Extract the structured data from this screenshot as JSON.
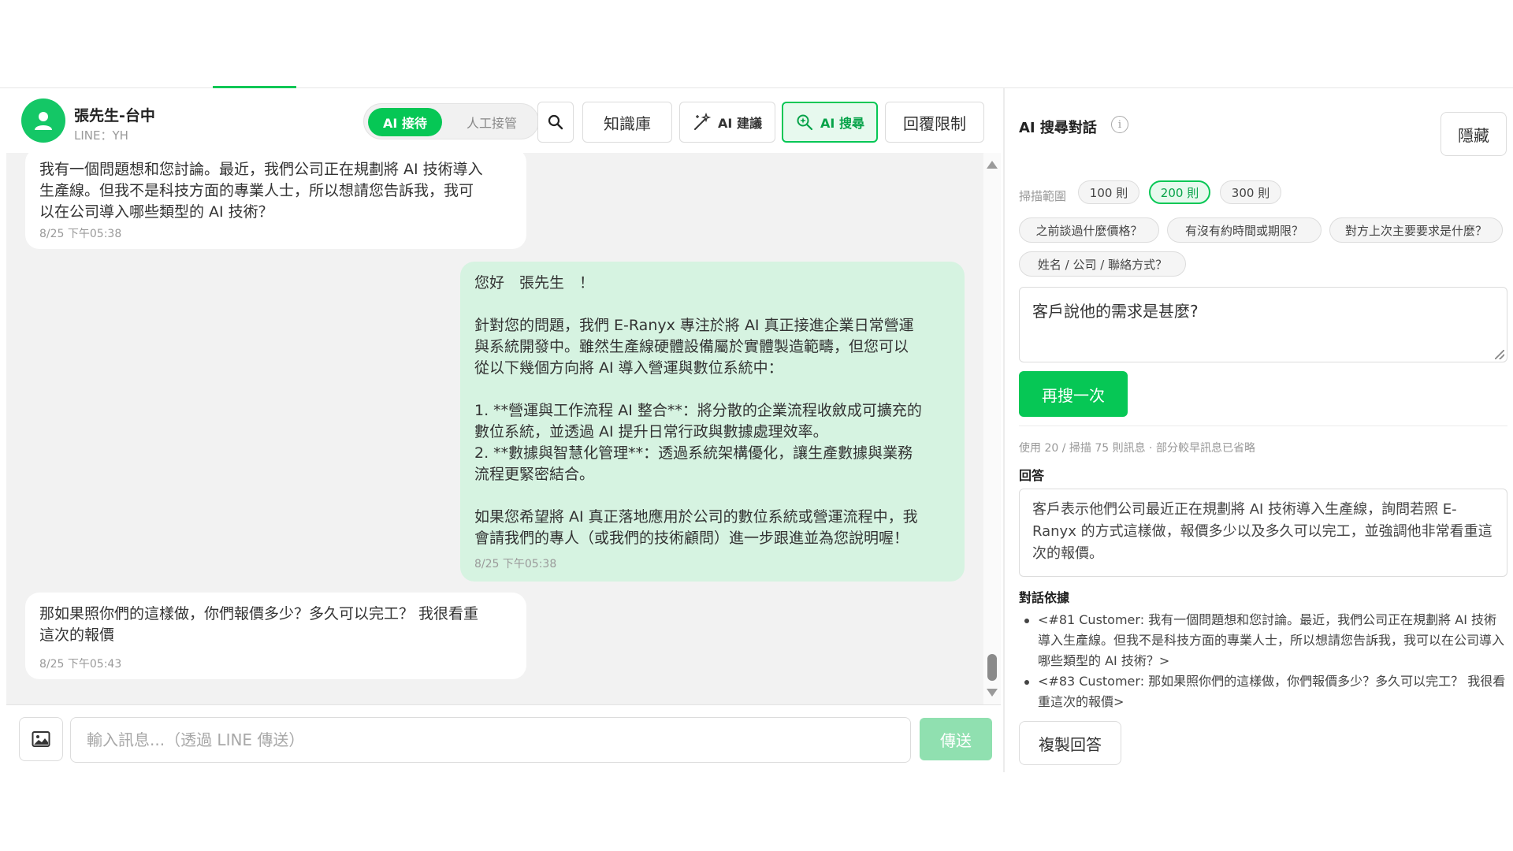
{
  "contact": {
    "name": "張先生-台中",
    "sub": "LINE：YH"
  },
  "header": {
    "mode_ai": "AI 接待",
    "mode_human": "人工接管",
    "knowledge_base": "知識庫",
    "ai_suggest": "AI 建議",
    "ai_search": "AI 搜尋",
    "reply_limit": "回覆限制"
  },
  "messages": [
    {
      "direction": "incoming",
      "text": "我有一個問題想和您討論。最近，我們公司正在規劃將 AI 技術導入\n生產線。但我不是科技方面的專業人士，所以想請您告訴我，我可\n以在公司導入哪些類型的 AI 技術？",
      "time": "8/25 下午05:38"
    },
    {
      "direction": "outgoing",
      "text": "您好　張先生　！\n\n針對您的問題，我們 E-Ranyx 專注於將 AI 真正接進企業日常營運\n與系統開發中。雖然生產線硬體設備屬於實體製造範疇，但您可以\n從以下幾個方向將 AI 導入營運與數位系統中：\n\n1. **營運與工作流程 AI 整合**：將分散的企業流程收斂成可擴充的\n數位系統，並透過 AI 提升日常行政與數據處理效率。\n2. **數據與智慧化管理**：透過系統架構優化，讓生產數據與業務\n流程更緊密結合。\n\n如果您希望將 AI 真正落地應用於公司的數位系統或營運流程中，我\n會請我們的專人（或我們的技術顧問）進一步跟進並為您說明喔！",
      "time": "8/25 下午05:38"
    },
    {
      "direction": "incoming",
      "text": "那如果照你們的這樣做，你們報價多少？多久可以完工？ 我很看重\n這次的報價",
      "time": "8/25 下午05:43"
    }
  ],
  "composer": {
    "placeholder": "輸入訊息...（透過 LINE 傳送）",
    "send": "傳送"
  },
  "ai_panel": {
    "title": "AI 搜尋對話",
    "info": "i",
    "hide": "隱藏",
    "scan_label": "掃描範圍",
    "scan_options": [
      "100 則",
      "200 則",
      "300 則"
    ],
    "scan_selected": "200 則",
    "quick_questions": [
      "之前談過什麼價格？",
      "有沒有約時間或期限？",
      "對方上次主要要求是什麼？",
      "姓名 / 公司 / 聯絡方式？"
    ],
    "query": "客戶說他的需求是甚麼?",
    "research_button": "再搜一次",
    "meta": "使用 20 / 掃描 75 則訊息 · 部分較早訊息已省略",
    "answer_label": "回答",
    "answer": "客戶表示他們公司最近正在規劃將 AI 技術導入生產線，詢問若照 E-Ranyx 的方式這樣做，報價多少以及多久可以完工，並強調他非常看重這次的報價。",
    "basis_label": "對話依據",
    "basis": [
      "<#81 Customer: 我有一個問題想和您討論。最近，我們公司正在規劃將 AI 技術導入生產線。但我不是科技方面的專業人士，所以想請您告訴我，我可以在公司導入哪些類型的 AI 技術？>",
      "<#83 Customer: 那如果照你們的這樣做，你們報價多少？多久可以完工？ 我很看重這次的報價>"
    ],
    "copy_button": "複製回答"
  },
  "colors": {
    "accent": "#06c755",
    "outgoing_bubble": "#d6f3e1",
    "send_disabled": "#90e0b0"
  }
}
